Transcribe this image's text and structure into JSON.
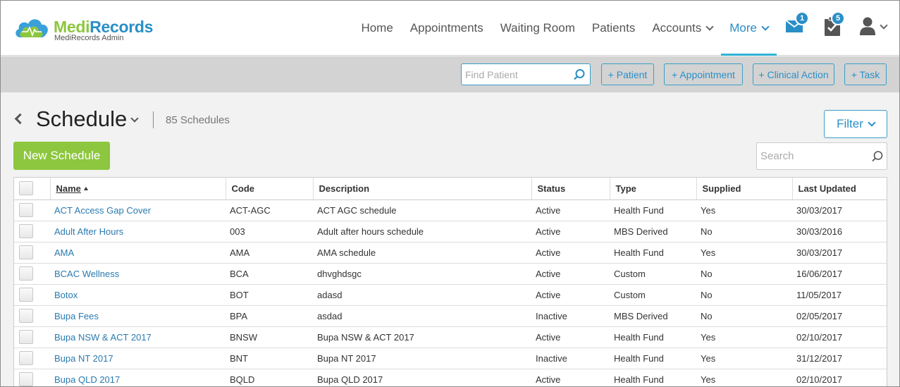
{
  "brand": {
    "name_part1": "Medi",
    "name_part2": "Records",
    "subtitle": "MediRecords Admin",
    "colors": {
      "green": "#8dc63f",
      "blue": "#2a8fc7"
    }
  },
  "nav": {
    "items": [
      {
        "label": "Home",
        "dropdown": false,
        "active": false
      },
      {
        "label": "Appointments",
        "dropdown": false,
        "active": false
      },
      {
        "label": "Waiting Room",
        "dropdown": false,
        "active": false
      },
      {
        "label": "Patients",
        "dropdown": false,
        "active": false
      },
      {
        "label": "Accounts",
        "dropdown": true,
        "active": false
      },
      {
        "label": "More",
        "dropdown": true,
        "active": true
      }
    ],
    "messages_badge": "1",
    "tasks_badge": "5",
    "icons": {
      "messages": "envelope-icon",
      "tasks": "clipboard-check-icon",
      "user": "user-icon"
    }
  },
  "actionbar": {
    "find_placeholder": "Find Patient",
    "buttons": {
      "patient": "+ Patient",
      "appointment": "+ Appointment",
      "clinical_action": "+ Clinical Action",
      "task": "+ Task"
    }
  },
  "page": {
    "title": "Schedule",
    "count": "85 Schedules",
    "filter_label": "Filter",
    "new_button": "New Schedule",
    "search_placeholder": "Search"
  },
  "table": {
    "headers": {
      "name": "Name",
      "code": "Code",
      "description": "Description",
      "status": "Status",
      "type": "Type",
      "supplied": "Supplied",
      "last_updated": "Last Updated"
    },
    "rows": [
      {
        "name": "ACT Access Gap Cover",
        "code": "ACT-AGC",
        "description": "ACT AGC schedule",
        "status": "Active",
        "type": "Health Fund",
        "supplied": "Yes",
        "last_updated": "30/03/2017"
      },
      {
        "name": "Adult After Hours",
        "code": "003",
        "description": "Adult after hours schedule",
        "status": "Active",
        "type": "MBS Derived",
        "supplied": "No",
        "last_updated": "30/03/2016"
      },
      {
        "name": "AMA",
        "code": "AMA",
        "description": "AMA schedule",
        "status": "Active",
        "type": "Health Fund",
        "supplied": "Yes",
        "last_updated": "30/03/2017"
      },
      {
        "name": "BCAC Wellness",
        "code": "BCA",
        "description": "dhvghdsgc",
        "status": "Active",
        "type": "Custom",
        "supplied": "No",
        "last_updated": "16/06/2017"
      },
      {
        "name": "Botox",
        "code": "BOT",
        "description": "adasd",
        "status": "Active",
        "type": "Custom",
        "supplied": "No",
        "last_updated": "11/05/2017"
      },
      {
        "name": "Bupa Fees",
        "code": "BPA",
        "description": "asdad",
        "status": "Inactive",
        "type": "MBS Derived",
        "supplied": "No",
        "last_updated": "02/05/2017"
      },
      {
        "name": "Bupa NSW & ACT 2017",
        "code": "BNSW",
        "description": "Bupa NSW & ACT 2017",
        "status": "Active",
        "type": "Health Fund",
        "supplied": "Yes",
        "last_updated": "02/10/2017"
      },
      {
        "name": "Bupa NT 2017",
        "code": "BNT",
        "description": "Bupa NT 2017",
        "status": "Inactive",
        "type": "Health Fund",
        "supplied": "Yes",
        "last_updated": "31/12/2017"
      },
      {
        "name": "Bupa QLD 2017",
        "code": "BQLD",
        "description": "Bupa QLD 2017",
        "status": "Active",
        "type": "Health Fund",
        "supplied": "Yes",
        "last_updated": "02/10/2017"
      }
    ]
  }
}
